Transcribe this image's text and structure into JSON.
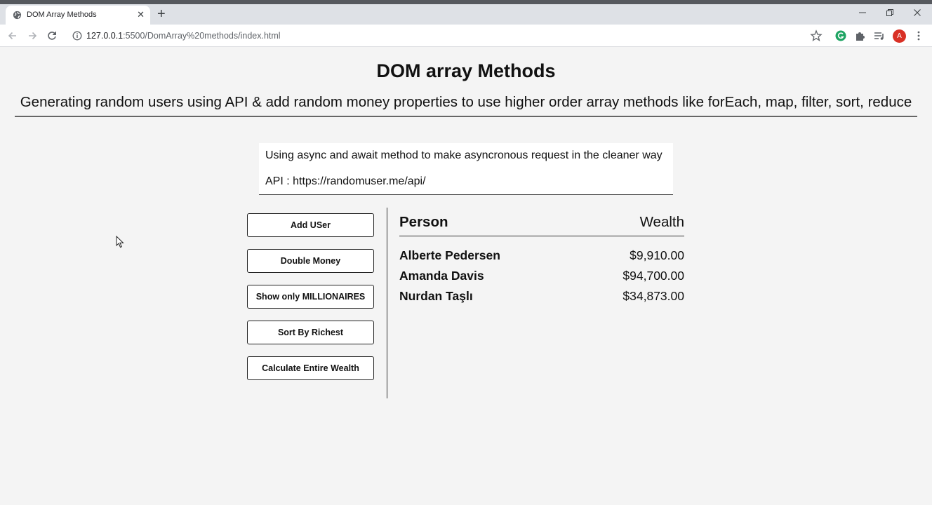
{
  "browser": {
    "tab_title": "DOM Array Methods",
    "url_host": "127.0.0.1",
    "url_rest": ":5500/DomArray%20methods/index.html",
    "avatar_letter": "A"
  },
  "page": {
    "title": "DOM array Methods",
    "subtitle": "Generating random users using API & add random money properties to use higher order array methods like forEach, map, filter, sort, reduce",
    "info_line_1": "Using async and await method to make asyncronous request in the cleaner way",
    "info_line_2": "API : https://randomuser.me/api/"
  },
  "buttons": {
    "add_user": "Add USer",
    "double_money": "Double Money",
    "show_millionaires": "Show only MILLIONAIRES",
    "sort_richest": "Sort By Richest",
    "calculate_wealth": "Calculate Entire Wealth"
  },
  "table": {
    "header_person": "Person",
    "header_wealth": "Wealth",
    "rows": [
      {
        "name": "Alberte Pedersen",
        "money": "$9,910.00"
      },
      {
        "name": "Amanda Davis",
        "money": "$94,700.00"
      },
      {
        "name": "Nurdan Taşlı",
        "money": "$34,873.00"
      }
    ]
  },
  "colors": {
    "page_bg": "#f4f4f4",
    "avatar_bg": "#d93025",
    "extension_green": "#1fa463"
  }
}
